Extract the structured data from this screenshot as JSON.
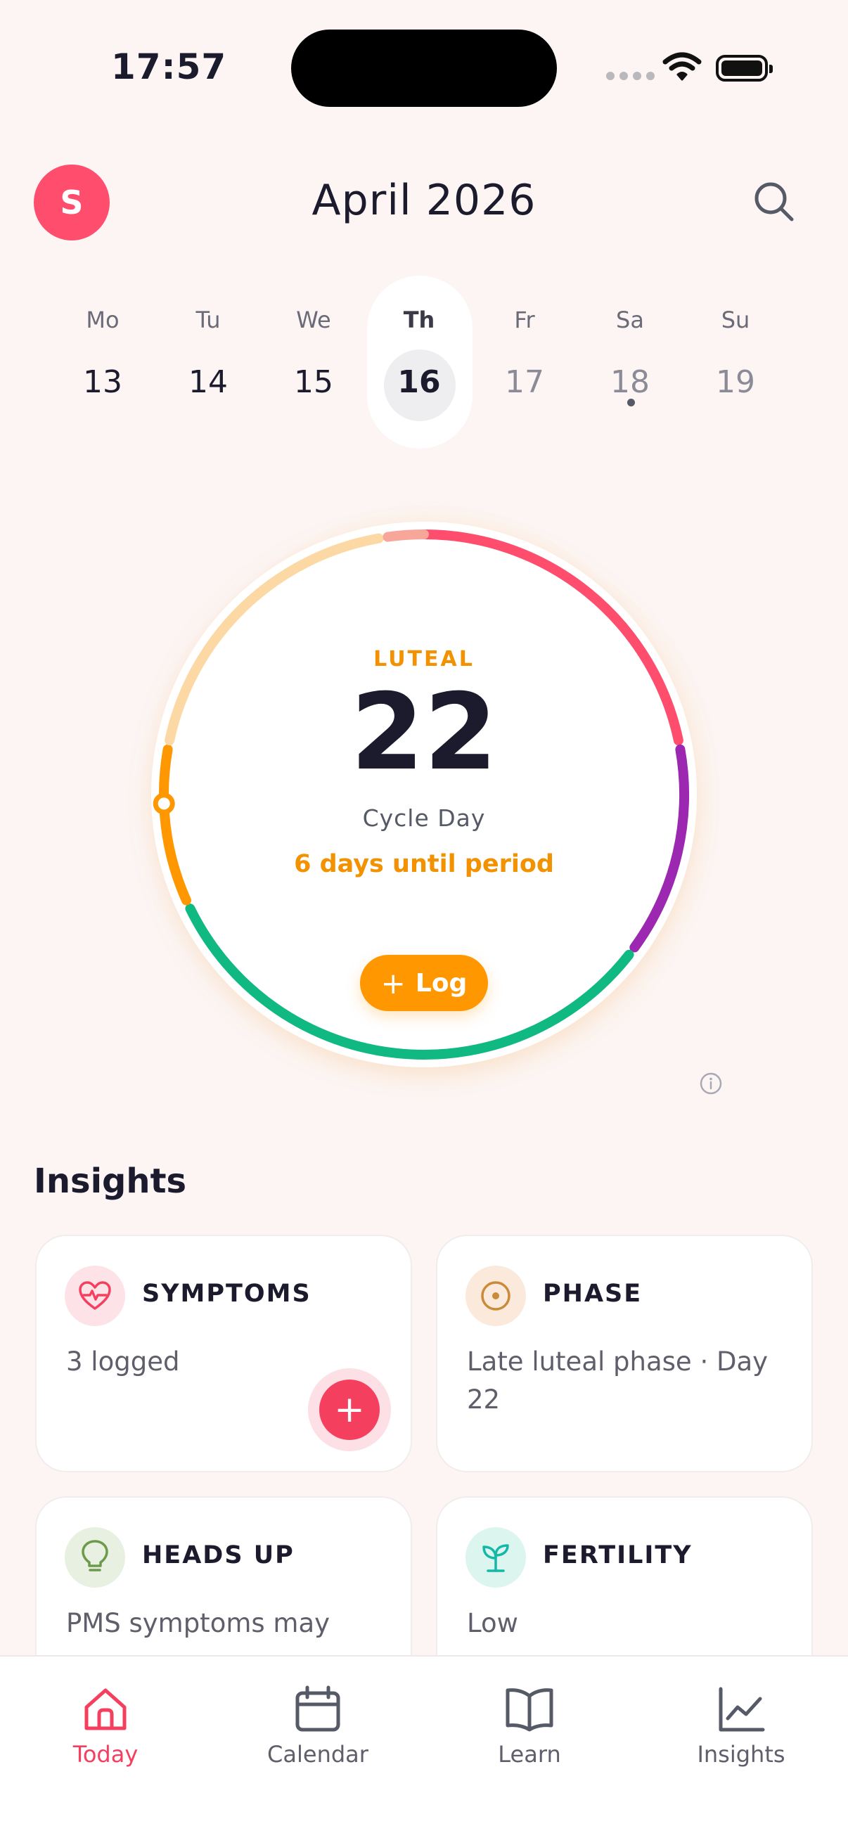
{
  "status_bar": {
    "time": "17:57"
  },
  "header": {
    "avatar_initial": "S",
    "month": "April 2026",
    "search_icon": "search-icon"
  },
  "week": [
    {
      "label": "Mo",
      "date": "13"
    },
    {
      "label": "Tu",
      "date": "14"
    },
    {
      "label": "We",
      "date": "15"
    },
    {
      "label": "Th",
      "date": "16",
      "selected": true
    },
    {
      "label": "Fr",
      "date": "17"
    },
    {
      "label": "Sa",
      "date": "18",
      "has_dot": true
    },
    {
      "label": "Su",
      "date": "19"
    }
  ],
  "cycle": {
    "phase": "LUTEAL",
    "day": "22",
    "day_label": "Cycle Day",
    "until": "6 days until period",
    "log_label": "Log",
    "colors": {
      "period": "#ff4d6d",
      "ovulation": "#9c27b0",
      "fertile": "#10b981",
      "luteal": "#ff9800",
      "luteal_late": "#fcd9a4",
      "pms": "#f8a59a"
    }
  },
  "insights": {
    "title": "Insights",
    "cards": [
      {
        "title": "SYMPTOMS",
        "body": "3 logged",
        "icon": "heart-pulse-icon"
      },
      {
        "title": "PHASE",
        "body": "Late luteal phase · Day 22",
        "icon": "target-icon"
      },
      {
        "title": "HEADS UP",
        "body": "PMS symptoms may",
        "icon": "lightbulb-icon"
      },
      {
        "title": "FERTILITY",
        "body": "Low",
        "icon": "sprout-icon"
      }
    ]
  },
  "tabs": [
    {
      "label": "Today",
      "icon": "home-icon",
      "active": true
    },
    {
      "label": "Calendar",
      "icon": "calendar-icon"
    },
    {
      "label": "Learn",
      "icon": "book-icon"
    },
    {
      "label": "Insights",
      "icon": "chart-icon"
    }
  ]
}
